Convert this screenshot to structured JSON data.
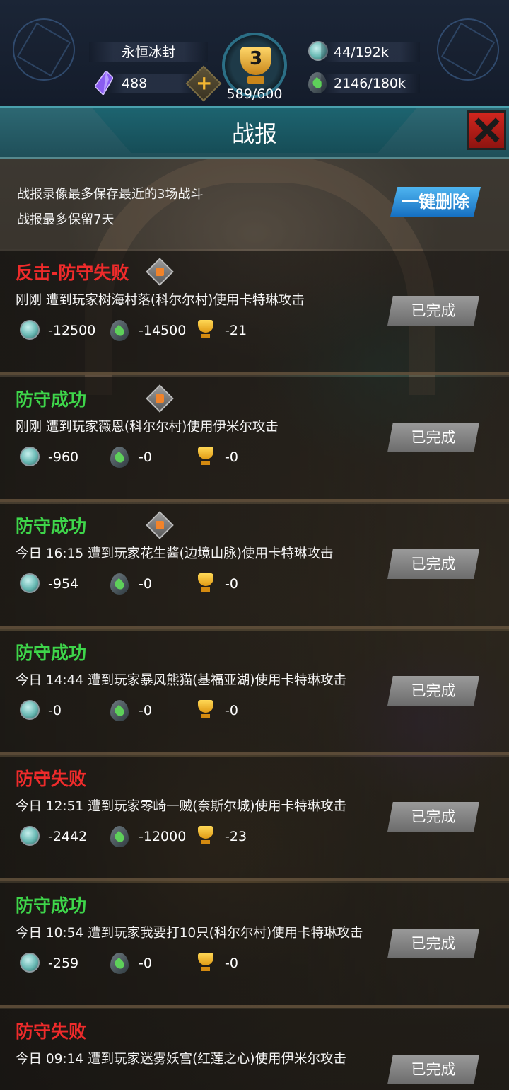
{
  "header": {
    "player_name": "永恒冰封",
    "gems": "488",
    "trophy_level": "3",
    "trophy_score": "589/600",
    "resource1": "44/192k",
    "resource2": "2146/180k",
    "plus_label": "+"
  },
  "title": "战报",
  "info": {
    "line1": "战报录像最多保存最近的3场战斗",
    "line2": "战报最多保留7天",
    "delete_all_label": "一键删除"
  },
  "reports": [
    {
      "title": "反击-防守失败",
      "result": "lose",
      "has_replay": true,
      "desc": "刚刚 遭到玩家树海村落(科尔尔村)使用卡特琳攻击",
      "coin": "-12500",
      "elixir": "-14500",
      "trophy": "-21",
      "button": "已完成"
    },
    {
      "title": "防守成功",
      "result": "win",
      "has_replay": true,
      "desc": "刚刚 遭到玩家薇恩(科尔尔村)使用伊米尔攻击",
      "coin": "-960",
      "elixir": "-0",
      "trophy": "-0",
      "button": "已完成"
    },
    {
      "title": "防守成功",
      "result": "win",
      "has_replay": true,
      "desc": "今日 16:15 遭到玩家花生酱(边境山脉)使用卡特琳攻击",
      "coin": "-954",
      "elixir": "-0",
      "trophy": "-0",
      "button": "已完成"
    },
    {
      "title": "防守成功",
      "result": "win",
      "has_replay": false,
      "desc": "今日 14:44 遭到玩家暴风熊猫(基福亚湖)使用卡特琳攻击",
      "coin": "-0",
      "elixir": "-0",
      "trophy": "-0",
      "button": "已完成"
    },
    {
      "title": "防守失败",
      "result": "lose",
      "has_replay": false,
      "desc": "今日 12:51 遭到玩家零崎一贼(奈斯尔城)使用卡特琳攻击",
      "coin": "-2442",
      "elixir": "-12000",
      "trophy": "-23",
      "button": "已完成"
    },
    {
      "title": "防守成功",
      "result": "win",
      "has_replay": false,
      "desc": "今日 10:54 遭到玩家我要打10只(科尔尔村)使用卡特琳攻击",
      "coin": "-259",
      "elixir": "-0",
      "trophy": "-0",
      "button": "已完成"
    },
    {
      "title": "防守失败",
      "result": "lose",
      "has_replay": false,
      "desc": "今日 09:14 遭到玩家迷雾妖宫(红莲之心)使用伊米尔攻击",
      "coin": "",
      "elixir": "",
      "trophy": "",
      "button": "已完成"
    }
  ]
}
